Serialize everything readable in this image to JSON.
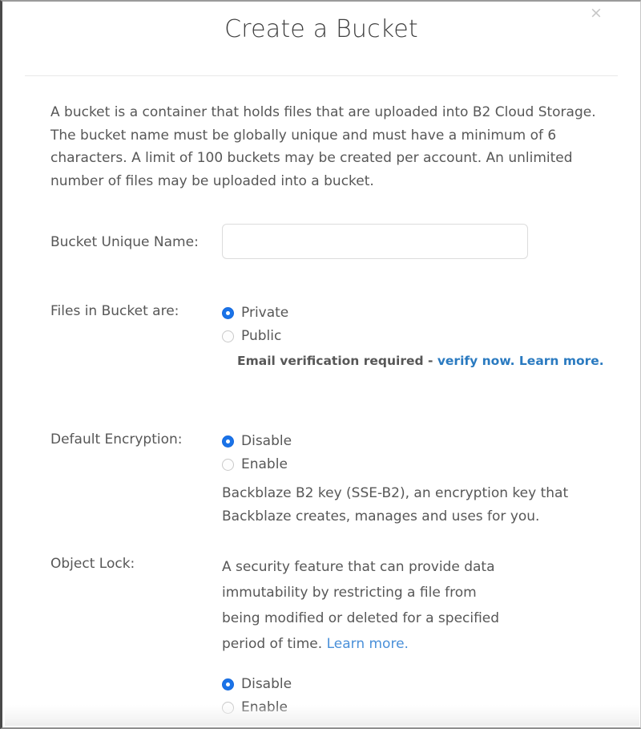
{
  "dialog": {
    "title": "Create a Bucket",
    "close_label": "×",
    "intro": "A bucket is a container that holds files that are uploaded into B2 Cloud Storage. The bucket name must be globally unique and must have a minimum of 6 characters. A limit of 100 buckets may be created per account. An unlimited number of files may be uploaded into a bucket."
  },
  "fields": {
    "bucket_name": {
      "label": "Bucket Unique Name:",
      "value": "",
      "placeholder": ""
    },
    "files_visibility": {
      "label": "Files in Bucket are:",
      "options": [
        {
          "label": "Private",
          "selected": true
        },
        {
          "label": "Public",
          "selected": false
        }
      ],
      "note_prefix": "Email verification required - ",
      "note_link_1": "verify now.",
      "note_link_2": " Learn more."
    },
    "default_encryption": {
      "label": "Default Encryption:",
      "options": [
        {
          "label": "Disable",
          "selected": true
        },
        {
          "label": "Enable",
          "selected": false
        }
      ],
      "help_line_1": "Backblaze B2 key (SSE-B2), an encryption key that",
      "help_line_2": "Backblaze creates, manages and uses for you."
    },
    "object_lock": {
      "label": "Object Lock:",
      "description": "A security feature that can provide data immutability by restricting a file from being modified or deleted for a specified period of time. ",
      "description_link": "Learn more.",
      "options": [
        {
          "label": "Disable",
          "selected": true
        },
        {
          "label": "Enable",
          "selected": false
        }
      ]
    }
  },
  "colors": {
    "accent_blue": "#1a73e8",
    "link_blue": "#4a90d9",
    "link_bold_blue": "#2a7ac0",
    "text_gray": "#575757",
    "title_gray": "#3f3f3f"
  }
}
